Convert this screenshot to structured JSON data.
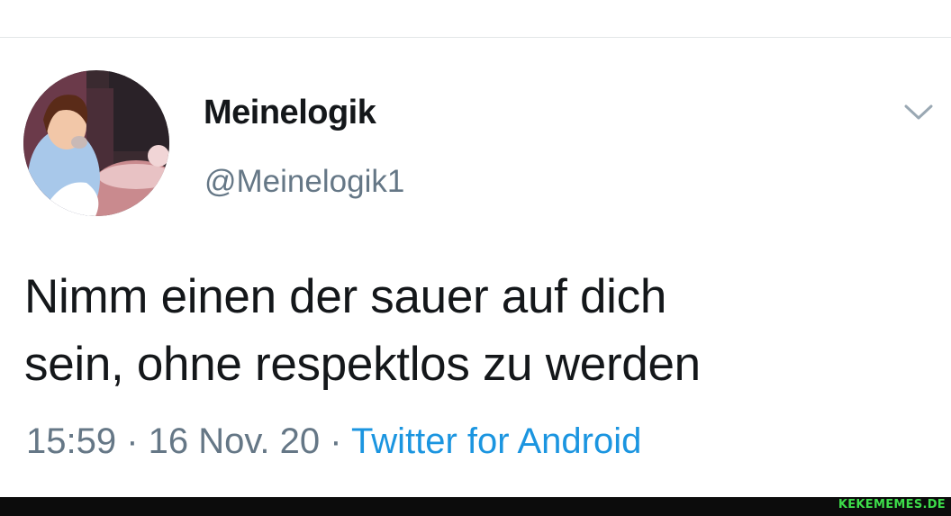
{
  "user": {
    "display_name": "Meinelogik",
    "handle": "@Meinelogik1",
    "avatar_icon": "avatar-princess-illustration"
  },
  "tweet": {
    "text_lines": [
      "Nimm einen der sauer auf dich",
      "sein, ohne respektlos zu werden"
    ],
    "time": "15:59",
    "separator": " · ",
    "date": "16 Nov. 20",
    "source": "Twitter for Android"
  },
  "menu": {
    "caret_icon": "chevron-down-icon"
  },
  "footer": {
    "watermark": "KEKEMEMES.DE"
  },
  "colors": {
    "text_primary": "#14171a",
    "text_secondary": "#657786",
    "link": "#1b95e0",
    "footer_bg": "#0c0c0c",
    "watermark": "#3ddc4a"
  }
}
